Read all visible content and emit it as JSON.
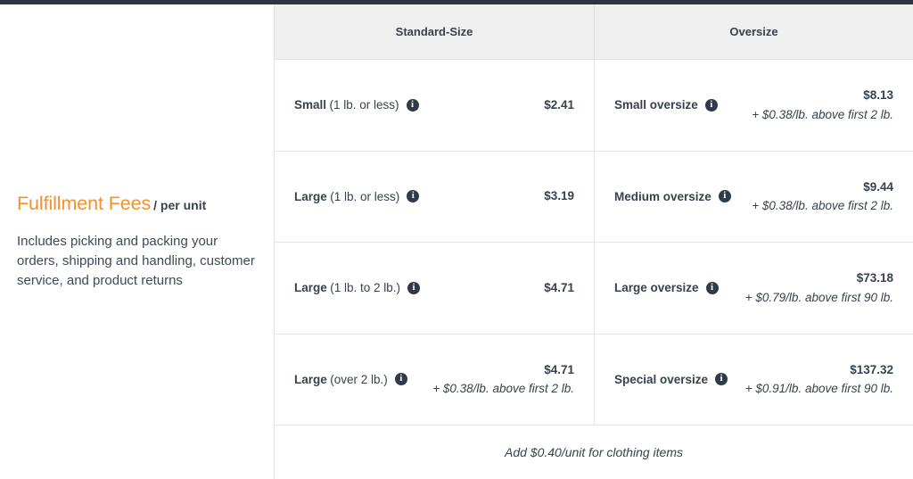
{
  "panel": {
    "title": "Fulfillment Fees",
    "per_unit": "/ per unit",
    "description": "Includes picking and packing your orders, shipping and handling, customer service, and product returns",
    "accent_color": "#f2912e"
  },
  "table": {
    "headers": {
      "standard": "Standard-Size",
      "oversize": "Oversize"
    },
    "rows": [
      {
        "standard": {
          "name": "Small",
          "qualifier": "(1 lb. or less)",
          "info": "info-icon",
          "price": "$2.41",
          "extra": ""
        },
        "oversize": {
          "name": "Small oversize",
          "qualifier": "",
          "info": "info-icon",
          "price": "$8.13",
          "extra": "+ $0.38/lb. above first 2 lb."
        }
      },
      {
        "standard": {
          "name": "Large",
          "qualifier": "(1 lb. or less)",
          "info": "info-icon",
          "price": "$3.19",
          "extra": ""
        },
        "oversize": {
          "name": "Medium oversize",
          "qualifier": "",
          "info": "info-icon",
          "price": "$9.44",
          "extra": "+ $0.38/lb. above first 2 lb."
        }
      },
      {
        "standard": {
          "name": "Large",
          "qualifier": "(1 lb. to 2 lb.)",
          "info": "info-icon",
          "price": "$4.71",
          "extra": ""
        },
        "oversize": {
          "name": "Large oversize",
          "qualifier": "",
          "info": "info-icon",
          "price": "$73.18",
          "extra": "+ $0.79/lb. above first 90 lb."
        }
      },
      {
        "standard": {
          "name": "Large",
          "qualifier": "(over 2 lb.)",
          "info": "info-icon",
          "price": "$4.71",
          "extra": "+ $0.38/lb. above first 2 lb."
        },
        "oversize": {
          "name": "Special oversize",
          "qualifier": "",
          "info": "info-icon",
          "price": "$137.32",
          "extra": "+ $0.91/lb. above first 90 lb."
        }
      }
    ],
    "footnote": "Add $0.40/unit for clothing items"
  }
}
